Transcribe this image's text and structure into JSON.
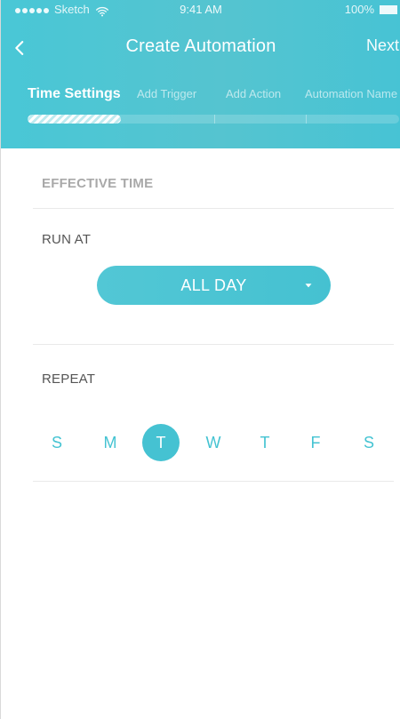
{
  "status_bar": {
    "carrier": "Sketch",
    "time": "9:41 AM",
    "battery": "100%"
  },
  "nav": {
    "title": "Create Automation",
    "next_label": "Next"
  },
  "steps": [
    {
      "label": "Time Settings",
      "active": true
    },
    {
      "label": "Add Trigger",
      "active": false
    },
    {
      "label": "Add Action",
      "active": false
    },
    {
      "label": "Automation Name",
      "active": false
    }
  ],
  "progress": {
    "fraction": 0.25
  },
  "sections": {
    "effective_time": {
      "title": "EFFECTIVE TIME"
    },
    "run_at": {
      "label": "RUN AT",
      "selected": "ALL DAY"
    },
    "repeat": {
      "label": "REPEAT",
      "days": [
        {
          "label": "S",
          "selected": false
        },
        {
          "label": "M",
          "selected": false
        },
        {
          "label": "T",
          "selected": true
        },
        {
          "label": "W",
          "selected": false
        },
        {
          "label": "T",
          "selected": false
        },
        {
          "label": "F",
          "selected": false
        },
        {
          "label": "S",
          "selected": false
        }
      ]
    }
  },
  "colors": {
    "accent": "#45c2d2",
    "header_bg": "#4cc5d4",
    "muted_text": "#a9a9a9",
    "divider": "#e9e9e9"
  },
  "icons": {
    "wifi": "wifi-icon",
    "battery": "battery-icon",
    "back": "chevron-left-icon",
    "dropdown": "chevron-down-icon"
  }
}
